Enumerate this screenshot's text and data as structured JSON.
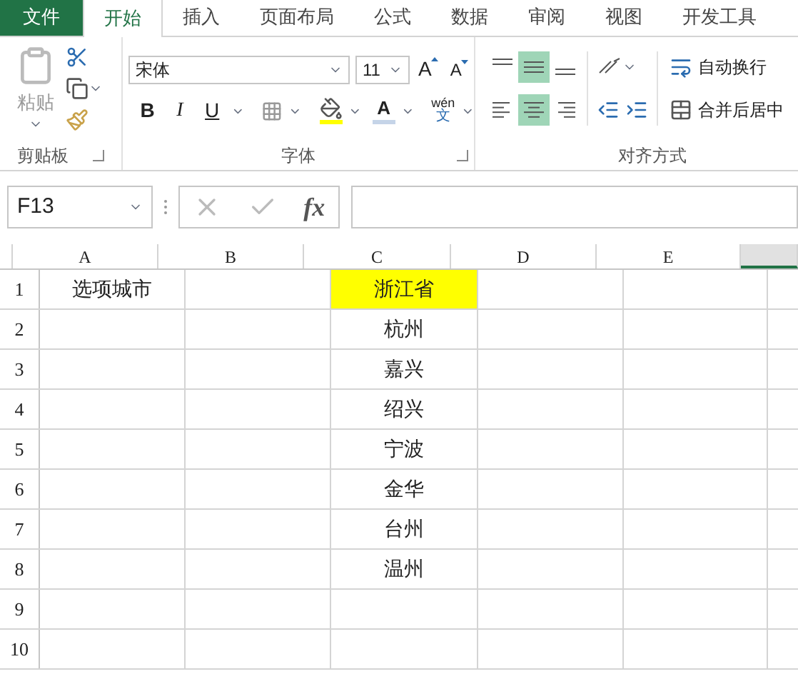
{
  "file_menu": "文件",
  "tabs": [
    {
      "label": "开始",
      "selected": true
    },
    {
      "label": "插入",
      "selected": false
    },
    {
      "label": "页面布局",
      "selected": false
    },
    {
      "label": "公式",
      "selected": false
    },
    {
      "label": "数据",
      "selected": false
    },
    {
      "label": "审阅",
      "selected": false
    },
    {
      "label": "视图",
      "selected": false
    },
    {
      "label": "开发工具",
      "selected": false
    }
  ],
  "ribbon": {
    "clipboard": {
      "label": "剪贴板",
      "paste": "粘贴"
    },
    "font": {
      "label": "字体",
      "font_name": "宋体",
      "font_size": "11",
      "grow": "A",
      "shrink": "A",
      "bold": "B",
      "italic": "I",
      "underline": "U",
      "font_color": "A",
      "phonetic_top": "wén",
      "phonetic_bottom": "文"
    },
    "alignment": {
      "label": "对齐方式",
      "vertical": [
        {
          "kind": "top",
          "selected": false
        },
        {
          "kind": "middle",
          "selected": true
        },
        {
          "kind": "bottom",
          "selected": false
        }
      ],
      "horizontal": [
        {
          "kind": "left",
          "selected": false
        },
        {
          "kind": "center",
          "selected": true
        },
        {
          "kind": "right",
          "selected": false
        }
      ],
      "wrap_text": "自动换行",
      "merge_center": "合并后居中"
    }
  },
  "formula_bar": {
    "name_box": "F13",
    "fx": "fx"
  },
  "sheet": {
    "columns": [
      {
        "label": "A",
        "selected": false
      },
      {
        "label": "B",
        "selected": false
      },
      {
        "label": "C",
        "selected": false
      },
      {
        "label": "D",
        "selected": false
      },
      {
        "label": "E",
        "selected": false
      },
      {
        "selected": true
      }
    ],
    "rows": [
      {
        "label": "1",
        "cells": [
          {
            "text": "选项城市"
          },
          {
            "text": ""
          },
          {
            "text": "浙江省",
            "color": "#ffff00"
          }
        ]
      },
      {
        "label": "2",
        "cells": [
          {
            "text": ""
          },
          {
            "text": ""
          },
          {
            "text": "杭州"
          }
        ]
      },
      {
        "label": "3",
        "cells": [
          {
            "text": ""
          },
          {
            "text": ""
          },
          {
            "text": "嘉兴"
          }
        ]
      },
      {
        "label": "4",
        "cells": [
          {
            "text": ""
          },
          {
            "text": ""
          },
          {
            "text": "绍兴"
          }
        ]
      },
      {
        "label": "5",
        "cells": [
          {
            "text": ""
          },
          {
            "text": ""
          },
          {
            "text": "宁波"
          }
        ]
      },
      {
        "label": "6",
        "cells": [
          {
            "text": ""
          },
          {
            "text": ""
          },
          {
            "text": "金华"
          }
        ]
      },
      {
        "label": "7",
        "cells": [
          {
            "text": ""
          },
          {
            "text": ""
          },
          {
            "text": "台州"
          }
        ]
      },
      {
        "label": "8",
        "cells": [
          {
            "text": ""
          },
          {
            "text": ""
          },
          {
            "text": "温州"
          }
        ]
      },
      {
        "label": "9",
        "cells": []
      },
      {
        "label": "10",
        "cells": []
      }
    ]
  }
}
